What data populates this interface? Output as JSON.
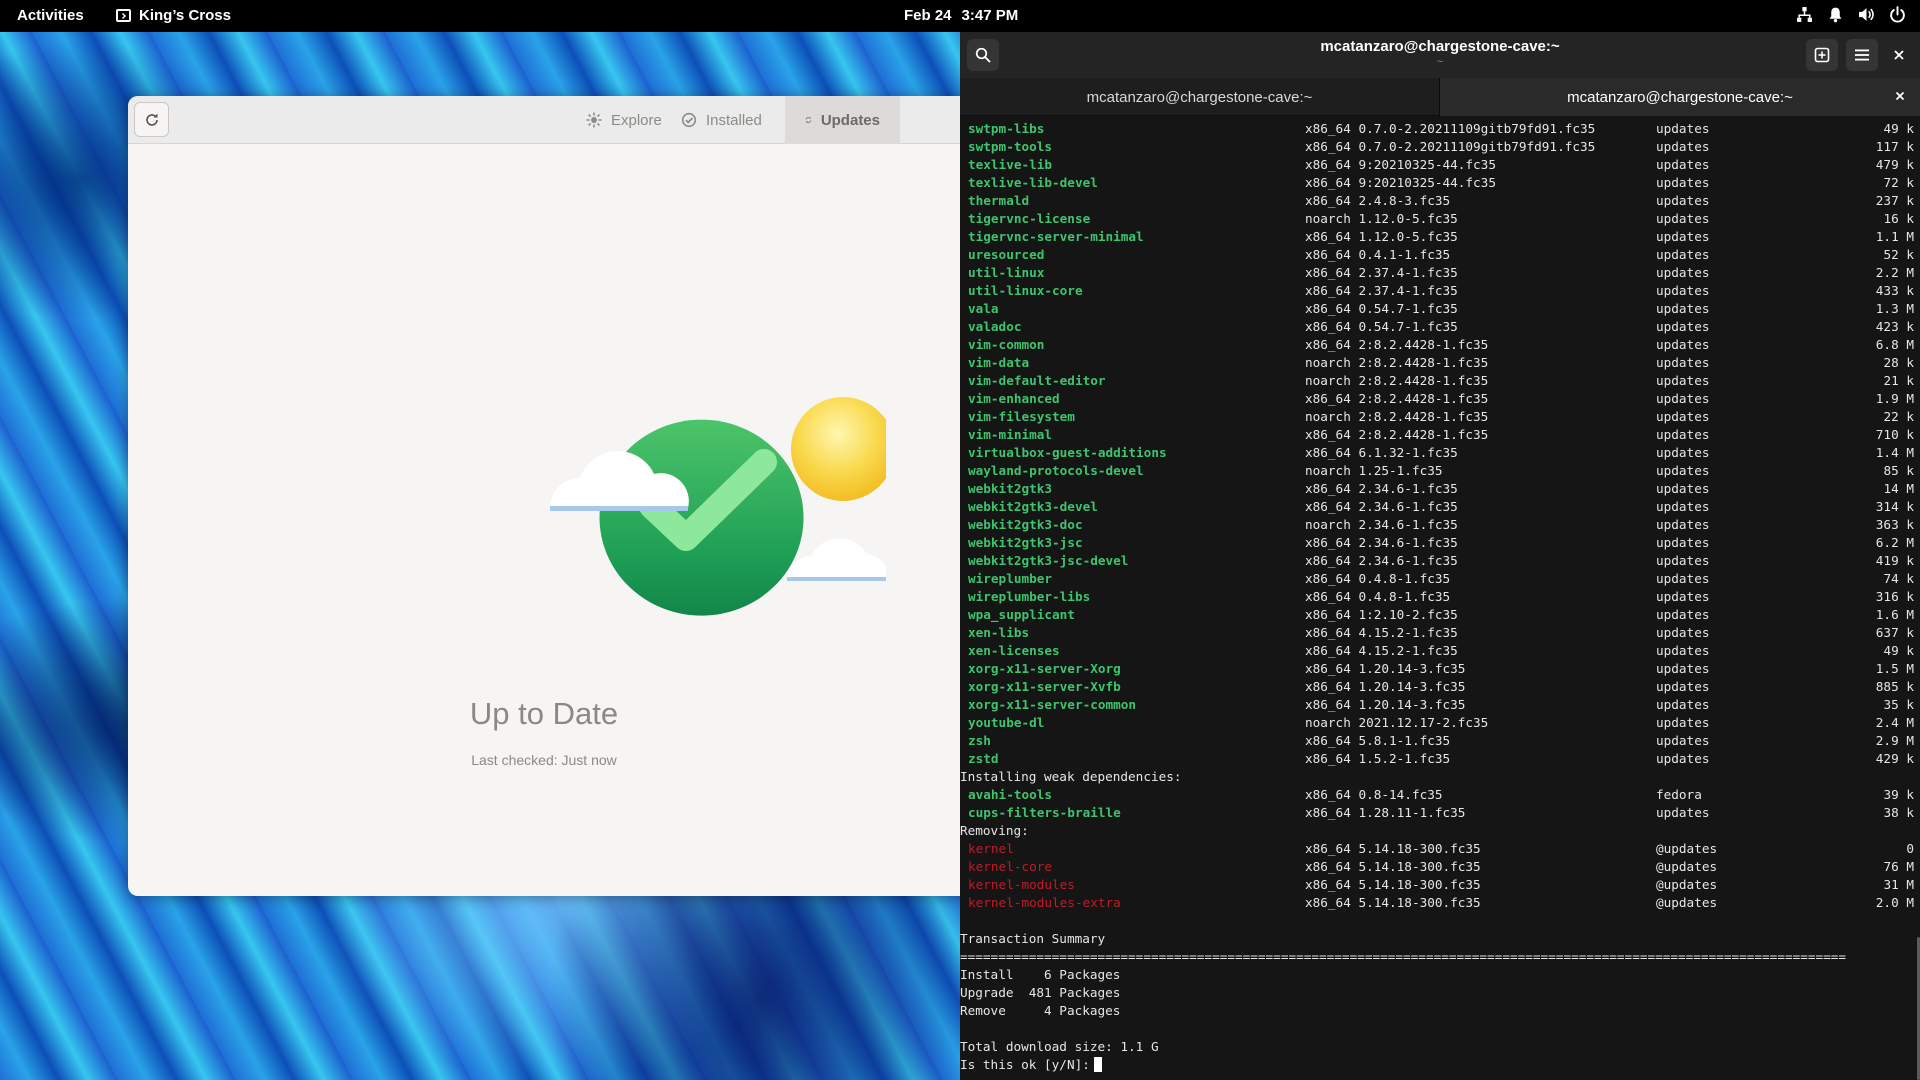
{
  "topbar": {
    "activities": "Activities",
    "app_name": "King’s Cross",
    "date": "Feb 24",
    "time": "3:47 PM",
    "tray_icons": [
      "network-icon",
      "bell-icon",
      "volume-icon",
      "power-icon"
    ]
  },
  "software": {
    "tabs": [
      {
        "label": "Explore",
        "icon": "explore-icon"
      },
      {
        "label": "Installed",
        "icon": "installed-check-icon"
      },
      {
        "label": "Updates",
        "icon": "updates-refresh-icon",
        "active": true
      }
    ],
    "status_title": "Up to Date",
    "status_subtitle": "Last checked: Just now"
  },
  "terminal": {
    "title": "mcatanzaro@chargestone-cave:~",
    "subtitle": "~",
    "tabs": [
      "mcatanzaro@chargestone-cave:~",
      "mcatanzaro@chargestone-cave:~"
    ],
    "packages": [
      {
        "name": "swtpm-libs",
        "ver": "x86_64 0.7.0-2.20211109gitb79fd91.fc35",
        "repo": "updates",
        "size": "49 k"
      },
      {
        "name": "swtpm-tools",
        "ver": "x86_64 0.7.0-2.20211109gitb79fd91.fc35",
        "repo": "updates",
        "size": "117 k"
      },
      {
        "name": "texlive-lib",
        "ver": "x86_64 9:20210325-44.fc35",
        "repo": "updates",
        "size": "479 k"
      },
      {
        "name": "texlive-lib-devel",
        "ver": "x86_64 9:20210325-44.fc35",
        "repo": "updates",
        "size": "72 k"
      },
      {
        "name": "thermald",
        "ver": "x86_64 2.4.8-3.fc35",
        "repo": "updates",
        "size": "237 k"
      },
      {
        "name": "tigervnc-license",
        "ver": "noarch 1.12.0-5.fc35",
        "repo": "updates",
        "size": "16 k"
      },
      {
        "name": "tigervnc-server-minimal",
        "ver": "x86_64 1.12.0-5.fc35",
        "repo": "updates",
        "size": "1.1 M"
      },
      {
        "name": "uresourced",
        "ver": "x86_64 0.4.1-1.fc35",
        "repo": "updates",
        "size": "52 k"
      },
      {
        "name": "util-linux",
        "ver": "x86_64 2.37.4-1.fc35",
        "repo": "updates",
        "size": "2.2 M"
      },
      {
        "name": "util-linux-core",
        "ver": "x86_64 2.37.4-1.fc35",
        "repo": "updates",
        "size": "433 k"
      },
      {
        "name": "vala",
        "ver": "x86_64 0.54.7-1.fc35",
        "repo": "updates",
        "size": "1.3 M"
      },
      {
        "name": "valadoc",
        "ver": "x86_64 0.54.7-1.fc35",
        "repo": "updates",
        "size": "423 k"
      },
      {
        "name": "vim-common",
        "ver": "x86_64 2:8.2.4428-1.fc35",
        "repo": "updates",
        "size": "6.8 M"
      },
      {
        "name": "vim-data",
        "ver": "noarch 2:8.2.4428-1.fc35",
        "repo": "updates",
        "size": "28 k"
      },
      {
        "name": "vim-default-editor",
        "ver": "noarch 2:8.2.4428-1.fc35",
        "repo": "updates",
        "size": "21 k"
      },
      {
        "name": "vim-enhanced",
        "ver": "x86_64 2:8.2.4428-1.fc35",
        "repo": "updates",
        "size": "1.9 M"
      },
      {
        "name": "vim-filesystem",
        "ver": "noarch 2:8.2.4428-1.fc35",
        "repo": "updates",
        "size": "22 k"
      },
      {
        "name": "vim-minimal",
        "ver": "x86_64 2:8.2.4428-1.fc35",
        "repo": "updates",
        "size": "710 k"
      },
      {
        "name": "virtualbox-guest-additions",
        "ver": "x86_64 6.1.32-1.fc35",
        "repo": "updates",
        "size": "1.4 M"
      },
      {
        "name": "wayland-protocols-devel",
        "ver": "noarch 1.25-1.fc35",
        "repo": "updates",
        "size": "85 k"
      },
      {
        "name": "webkit2gtk3",
        "ver": "x86_64 2.34.6-1.fc35",
        "repo": "updates",
        "size": "14 M"
      },
      {
        "name": "webkit2gtk3-devel",
        "ver": "x86_64 2.34.6-1.fc35",
        "repo": "updates",
        "size": "314 k"
      },
      {
        "name": "webkit2gtk3-doc",
        "ver": "noarch 2.34.6-1.fc35",
        "repo": "updates",
        "size": "363 k"
      },
      {
        "name": "webkit2gtk3-jsc",
        "ver": "x86_64 2.34.6-1.fc35",
        "repo": "updates",
        "size": "6.2 M"
      },
      {
        "name": "webkit2gtk3-jsc-devel",
        "ver": "x86_64 2.34.6-1.fc35",
        "repo": "updates",
        "size": "419 k"
      },
      {
        "name": "wireplumber",
        "ver": "x86_64 0.4.8-1.fc35",
        "repo": "updates",
        "size": "74 k"
      },
      {
        "name": "wireplumber-libs",
        "ver": "x86_64 0.4.8-1.fc35",
        "repo": "updates",
        "size": "316 k"
      },
      {
        "name": "wpa_supplicant",
        "ver": "x86_64 1:2.10-2.fc35",
        "repo": "updates",
        "size": "1.6 M"
      },
      {
        "name": "xen-libs",
        "ver": "x86_64 4.15.2-1.fc35",
        "repo": "updates",
        "size": "637 k"
      },
      {
        "name": "xen-licenses",
        "ver": "x86_64 4.15.2-1.fc35",
        "repo": "updates",
        "size": "49 k"
      },
      {
        "name": "xorg-x11-server-Xorg",
        "ver": "x86_64 1.20.14-3.fc35",
        "repo": "updates",
        "size": "1.5 M"
      },
      {
        "name": "xorg-x11-server-Xvfb",
        "ver": "x86_64 1.20.14-3.fc35",
        "repo": "updates",
        "size": "885 k"
      },
      {
        "name": "xorg-x11-server-common",
        "ver": "x86_64 1.20.14-3.fc35",
        "repo": "updates",
        "size": "35 k"
      },
      {
        "name": "youtube-dl",
        "ver": "noarch 2021.12.17-2.fc35",
        "repo": "updates",
        "size": "2.4 M"
      },
      {
        "name": "zsh",
        "ver": "x86_64 5.8.1-1.fc35",
        "repo": "updates",
        "size": "2.9 M"
      },
      {
        "name": "zstd",
        "ver": "x86_64 1.5.2-1.fc35",
        "repo": "updates",
        "size": "429 k"
      }
    ],
    "weak_heading": "Installing weak dependencies:",
    "weak_packages": [
      {
        "name": "avahi-tools",
        "ver": "x86_64 0.8-14.fc35",
        "repo": "fedora",
        "size": "39 k"
      },
      {
        "name": "cups-filters-braille",
        "ver": "x86_64 1.28.11-1.fc35",
        "repo": "updates",
        "size": "38 k"
      }
    ],
    "removing_heading": "Removing:",
    "removed_packages": [
      {
        "name": "kernel",
        "ver": "x86_64 5.14.18-300.fc35",
        "repo": "@updates",
        "size": "0"
      },
      {
        "name": "kernel-core",
        "ver": "x86_64 5.14.18-300.fc35",
        "repo": "@updates",
        "size": "76 M"
      },
      {
        "name": "kernel-modules",
        "ver": "x86_64 5.14.18-300.fc35",
        "repo": "@updates",
        "size": "31 M"
      },
      {
        "name": "kernel-modules-extra",
        "ver": "x86_64 5.14.18-300.fc35",
        "repo": "@updates",
        "size": "2.0 M"
      }
    ],
    "summary_heading": "Transaction Summary",
    "separator": "====================================================================================================================",
    "summary_lines": [
      "Install    6 Packages",
      "Upgrade  481 Packages",
      "Remove     4 Packages"
    ],
    "download_size": "Total download size: 1.1 G",
    "prompt": "Is this ok [y/N]:",
    "colors": {
      "installed": "#3ec46d",
      "removed": "#c01c28"
    }
  }
}
